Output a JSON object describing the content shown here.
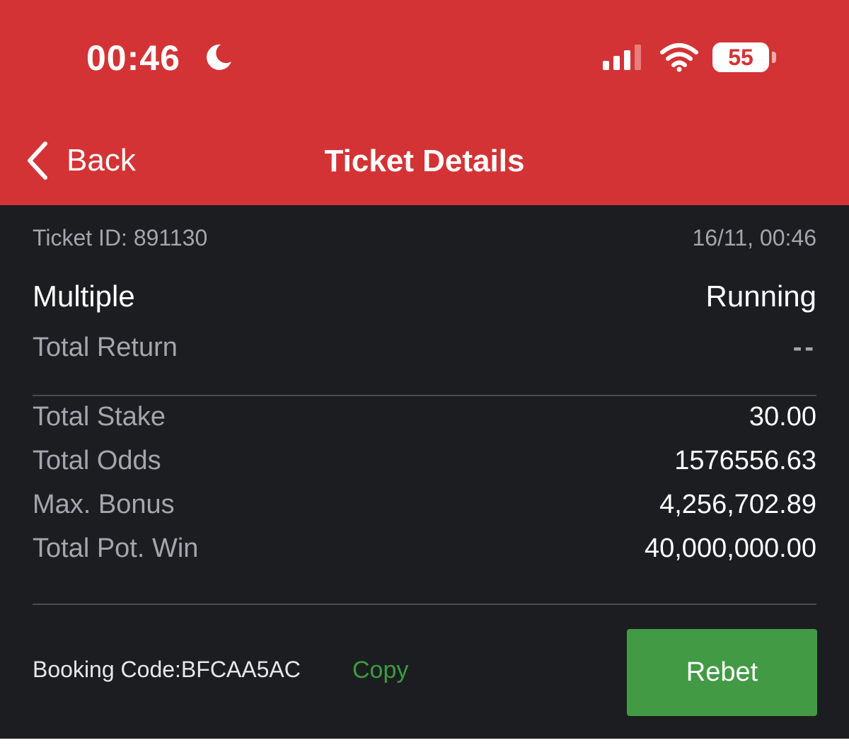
{
  "status_bar": {
    "time": "00:46",
    "battery": "55",
    "icons": [
      "moon-icon",
      "signal-icon",
      "wifi-icon",
      "battery-icon"
    ]
  },
  "nav": {
    "back_label": "Back",
    "title": "Ticket Details"
  },
  "ticket": {
    "id_text": "Ticket ID: 891130",
    "datetime": "16/11, 00:46",
    "type": "Multiple",
    "status": "Running",
    "total_return_label": "Total Return",
    "total_return_value": "--"
  },
  "summary": {
    "stake_label": "Total Stake",
    "stake_value": "30.00",
    "odds_label": "Total Odds",
    "odds_value": "1576556.63",
    "bonus_label": "Max. Bonus",
    "bonus_value": "4,256,702.89",
    "potwin_label": "Total Pot. Win",
    "potwin_value": "40,000,000.00"
  },
  "footer": {
    "booking_code": "Booking Code:BFCAA5AC",
    "copy_label": "Copy",
    "rebet_label": "Rebet"
  },
  "colors": {
    "header": "#d33335",
    "background": "#1c1d21",
    "accent_green": "#439a45",
    "muted_text": "#a3a6ad"
  }
}
